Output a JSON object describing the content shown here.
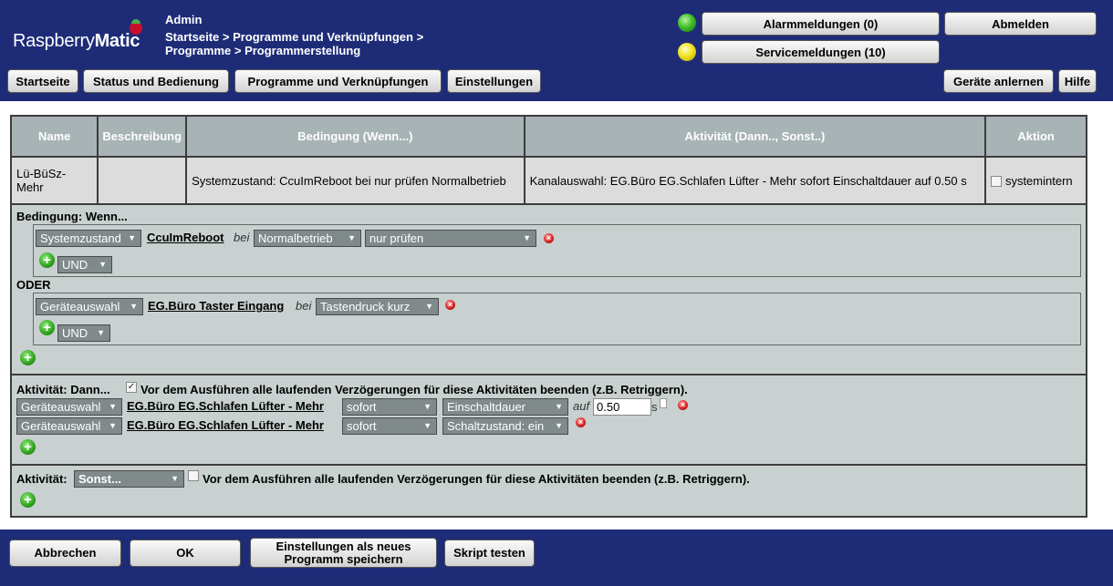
{
  "header": {
    "logo_main": "Raspberry",
    "logo_bold": "Matic",
    "user": "Admin",
    "breadcrumb": "Startseite > Programme und Verknüpfungen > Programme > Programmerstellung",
    "alarm_button": "Alarmmeldungen (0)",
    "service_button": "Servicemeldungen (10)",
    "logout_button": "Abmelden",
    "alarm_led_color": "#3fbf2a",
    "service_led_color": "#f2e31c",
    "nav": [
      "Startseite",
      "Status und Bedienung",
      "Programme und Verknüpfungen",
      "Einstellungen"
    ],
    "learn_button": "Geräte anlernen",
    "help_button": "Hilfe"
  },
  "table": {
    "headers": [
      "Name",
      "Beschreibung",
      "Bedingung (Wenn...)",
      "Aktivität (Dann.., Sonst..)",
      "Aktion"
    ],
    "row": {
      "name": "Lü-BüSz-Mehr",
      "description": "",
      "condition": "Systemzustand: CcuImReboot bei nur prüfen Normalbetrieb",
      "activity": "Kanalauswahl: EG.Büro EG.Schlafen Lüfter - Mehr sofort Einschaltdauer auf 0.50 s",
      "action_label": "systemintern",
      "action_checked": false
    }
  },
  "condition": {
    "title": "Bedingung: Wenn...",
    "or_label": "ODER",
    "block1": {
      "type": "Systemzustand",
      "target": "CcuImReboot",
      "bei": "bei",
      "state": "Normalbetrieb",
      "mode": "nur prüfen",
      "logic": "UND"
    },
    "block2": {
      "type": "Geräteauswahl",
      "target": "EG.Büro Taster Eingang",
      "bei": "bei",
      "state": "Tastendruck kurz",
      "logic": "UND"
    }
  },
  "then": {
    "title": "Aktivität: Dann...",
    "retrigger_label": "Vor dem Ausführen alle laufenden Verzögerungen für diese Aktivitäten beenden (z.B. Retriggern).",
    "retrigger_checked": true,
    "rows": [
      {
        "type": "Geräteauswahl",
        "target": "EG.Büro EG.Schlafen Lüfter - Mehr",
        "timing": "sofort",
        "param": "Einschaltdauer",
        "auf": "auf",
        "value": "0.50",
        "unit": "s"
      },
      {
        "type": "Geräteauswahl",
        "target": "EG.Büro EG.Schlafen Lüfter - Mehr",
        "timing": "sofort",
        "param": "Schaltzustand: ein"
      }
    ]
  },
  "else": {
    "title": "Aktivität:",
    "select": "Sonst...",
    "retrigger_label": "Vor dem Ausführen alle laufenden Verzögerungen für diese Aktivitäten beenden (z.B. Retriggern).",
    "retrigger_checked": false
  },
  "footer": {
    "cancel": "Abbrechen",
    "ok": "OK",
    "save_new": "Einstellungen als neues Programm speichern",
    "test_script": "Skript testen"
  }
}
